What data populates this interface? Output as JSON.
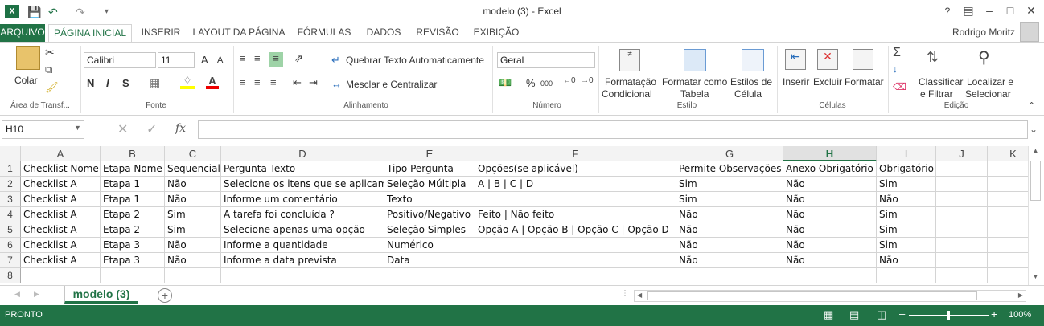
{
  "window": {
    "title": "modelo (3) - Excel",
    "help": "?"
  },
  "tabs": [
    "ARQUIVO",
    "PÁGINA INICIAL",
    "INSERIR",
    "LAYOUT DA PÁGINA",
    "FÓRMULAS",
    "DADOS",
    "REVISÃO",
    "EXIBIÇÃO"
  ],
  "user": "Rodrigo Moritz",
  "ribbon": {
    "clipboard": {
      "paste": "Colar",
      "label": "Área de Transf..."
    },
    "font": {
      "name": "Calibri",
      "size": "11",
      "bold": "N",
      "italic": "I",
      "underline": "S",
      "grow": "A",
      "shrink": "A",
      "label": "Fonte"
    },
    "alignment": {
      "wrap": "Quebrar Texto Automaticamente",
      "merge": "Mesclar e Centralizar",
      "label": "Alinhamento"
    },
    "number": {
      "format": "Geral",
      "percent": "%",
      "thousands": "000",
      "label": "Número"
    },
    "styles": {
      "conditional_1": "Formatação",
      "conditional_2": "Condicional",
      "table_1": "Formatar como",
      "table_2": "Tabela",
      "cell_1": "Estilos de",
      "cell_2": "Célula",
      "label": "Estilo"
    },
    "cells": {
      "insert": "Inserir",
      "delete": "Excluir",
      "format": "Formatar",
      "label": "Células"
    },
    "editing": {
      "sort_1": "Classificar",
      "sort_2": "e Filtrar",
      "find_1": "Localizar e",
      "find_2": "Selecionar",
      "label": "Edição"
    }
  },
  "formula_bar": {
    "name_box": "H10",
    "fx": "fx",
    "value": ""
  },
  "columns": [
    "A",
    "B",
    "C",
    "D",
    "E",
    "F",
    "G",
    "H",
    "I",
    "J",
    "K"
  ],
  "selected_column": "H",
  "rows": [
    [
      "Checklist Nome",
      "Etapa Nome",
      "Sequencial",
      "Pergunta Texto",
      "Tipo Pergunta",
      "Opções(se aplicável)",
      "Permite Observações",
      "Anexo Obrigatório",
      "Obrigatório",
      "",
      ""
    ],
    [
      "Checklist A",
      "Etapa 1",
      "Não",
      "Selecione os itens que se aplicam",
      "Seleção Múltipla",
      "A | B | C | D",
      "Sim",
      "Não",
      "Sim",
      "",
      ""
    ],
    [
      "Checklist A",
      "Etapa 1",
      "Não",
      "Informe um comentário",
      "Texto",
      "",
      "Sim",
      "Não",
      "Não",
      "",
      ""
    ],
    [
      "Checklist A",
      "Etapa 2",
      "Sim",
      "A tarefa foi concluída ?",
      "Positivo/Negativo",
      "Feito | Não feito",
      "Não",
      "Não",
      "Sim",
      "",
      ""
    ],
    [
      "Checklist A",
      "Etapa 2",
      "Sim",
      "Selecione apenas uma opção",
      "Seleção Simples",
      "Opção A | Opção B | Opção C | Opção D",
      "Não",
      "Não",
      "Sim",
      "",
      ""
    ],
    [
      "Checklist A",
      "Etapa 3",
      "Não",
      "Informe a quantidade",
      "Numérico",
      "",
      "Não",
      "Não",
      "Sim",
      "",
      ""
    ],
    [
      "Checklist A",
      "Etapa 3",
      "Não",
      "Informe a data prevista",
      "Data",
      "",
      "Não",
      "Não",
      "Não",
      "",
      ""
    ],
    [
      "",
      "",
      "",
      "",
      "",
      "",
      "",
      "",
      "",
      "",
      ""
    ]
  ],
  "row_numbers": [
    "1",
    "2",
    "3",
    "4",
    "5",
    "6",
    "7",
    "8"
  ],
  "sheet": {
    "name": "modelo (3)",
    "add": "+"
  },
  "status": {
    "mode": "PRONTO",
    "zoom": "100%",
    "minus": "–",
    "plus": "+"
  }
}
